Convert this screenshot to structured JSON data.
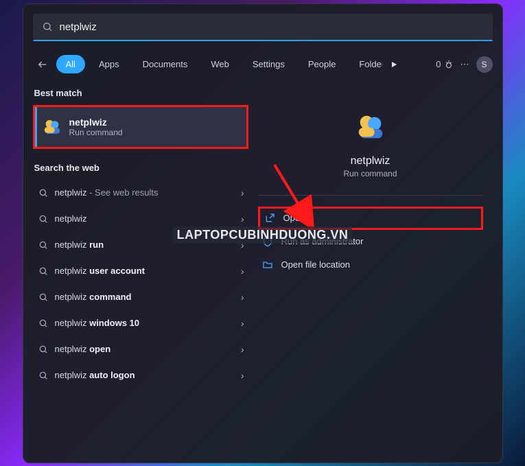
{
  "search": {
    "value": "netplwiz",
    "placeholder": ""
  },
  "tabs": {
    "items": [
      "All",
      "Apps",
      "Documents",
      "Web",
      "Settings",
      "People",
      "Folders"
    ],
    "active_index": 0
  },
  "top_right": {
    "rewards_count": "0",
    "more_label": "⋯",
    "avatar_initial": "S"
  },
  "sections": {
    "best_match_label": "Best match",
    "search_web_label": "Search the web"
  },
  "best_match": {
    "title": "netplwiz",
    "subtitle": "Run command"
  },
  "web_results": [
    {
      "prefix": "netplwiz",
      "bold": "",
      "hint": " - See web results"
    },
    {
      "prefix": "netplwiz",
      "bold": "",
      "hint": ""
    },
    {
      "prefix": "netplwiz ",
      "bold": "run",
      "hint": ""
    },
    {
      "prefix": "netplwiz ",
      "bold": "user account",
      "hint": ""
    },
    {
      "prefix": "netplwiz ",
      "bold": "command",
      "hint": ""
    },
    {
      "prefix": "netplwiz ",
      "bold": "windows 10",
      "hint": ""
    },
    {
      "prefix": "netplwiz ",
      "bold": "open",
      "hint": ""
    },
    {
      "prefix": "netplwiz ",
      "bold": "auto logon",
      "hint": ""
    }
  ],
  "preview": {
    "title": "netplwiz",
    "subtitle": "Run command",
    "actions": {
      "open": "Open",
      "run_admin": "Run as administrator",
      "file_loc": "Open file location"
    }
  },
  "watermark": "LAPTOPCUBINHDUONG.VN"
}
